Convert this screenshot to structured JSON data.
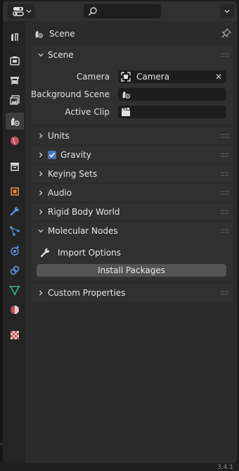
{
  "header": {
    "editor_type_icon": "properties-editor-icon",
    "search_icon": "search-icon",
    "search_value": ""
  },
  "tabs": [
    {
      "name": "tool",
      "icon": "tool-icon"
    },
    {
      "name": "render",
      "icon": "render-icon"
    },
    {
      "name": "output",
      "icon": "output-icon"
    },
    {
      "name": "view-layer",
      "icon": "view-layer-icon"
    },
    {
      "name": "scene",
      "icon": "scene-icon",
      "active": true
    },
    {
      "name": "world",
      "icon": "world-icon"
    },
    {
      "name": "collection",
      "icon": "collection-icon"
    },
    {
      "name": "object",
      "icon": "object-icon"
    },
    {
      "name": "modifiers",
      "icon": "wrench-icon"
    },
    {
      "name": "particles",
      "icon": "particles-icon"
    },
    {
      "name": "physics",
      "icon": "physics-icon"
    },
    {
      "name": "constraints",
      "icon": "constraints-icon"
    },
    {
      "name": "data",
      "icon": "mesh-data-icon"
    },
    {
      "name": "material",
      "icon": "material-icon"
    },
    {
      "name": "texture",
      "icon": "texture-icon"
    }
  ],
  "context": {
    "title": "Scene"
  },
  "panels": {
    "scene": {
      "title": "Scene",
      "camera_label": "Camera",
      "camera_value": "Camera",
      "background_scene_label": "Background Scene",
      "background_scene_value": "",
      "active_clip_label": "Active Clip",
      "active_clip_value": ""
    },
    "units": {
      "title": "Units"
    },
    "gravity": {
      "title": "Gravity",
      "checked": true
    },
    "keying_sets": {
      "title": "Keying Sets"
    },
    "audio": {
      "title": "Audio"
    },
    "rigid_body_world": {
      "title": "Rigid Body World"
    },
    "molecular_nodes": {
      "title": "Molecular Nodes",
      "import_options": "Import Options",
      "install_packages": "Install Packages"
    },
    "custom_properties": {
      "title": "Custom Properties"
    }
  },
  "footer": {
    "version": "3.4.1"
  },
  "colors": {
    "accent": "#4772b3",
    "panel_bg": "#303030",
    "field_bg": "#1d1d1d",
    "button_bg": "#545454"
  }
}
